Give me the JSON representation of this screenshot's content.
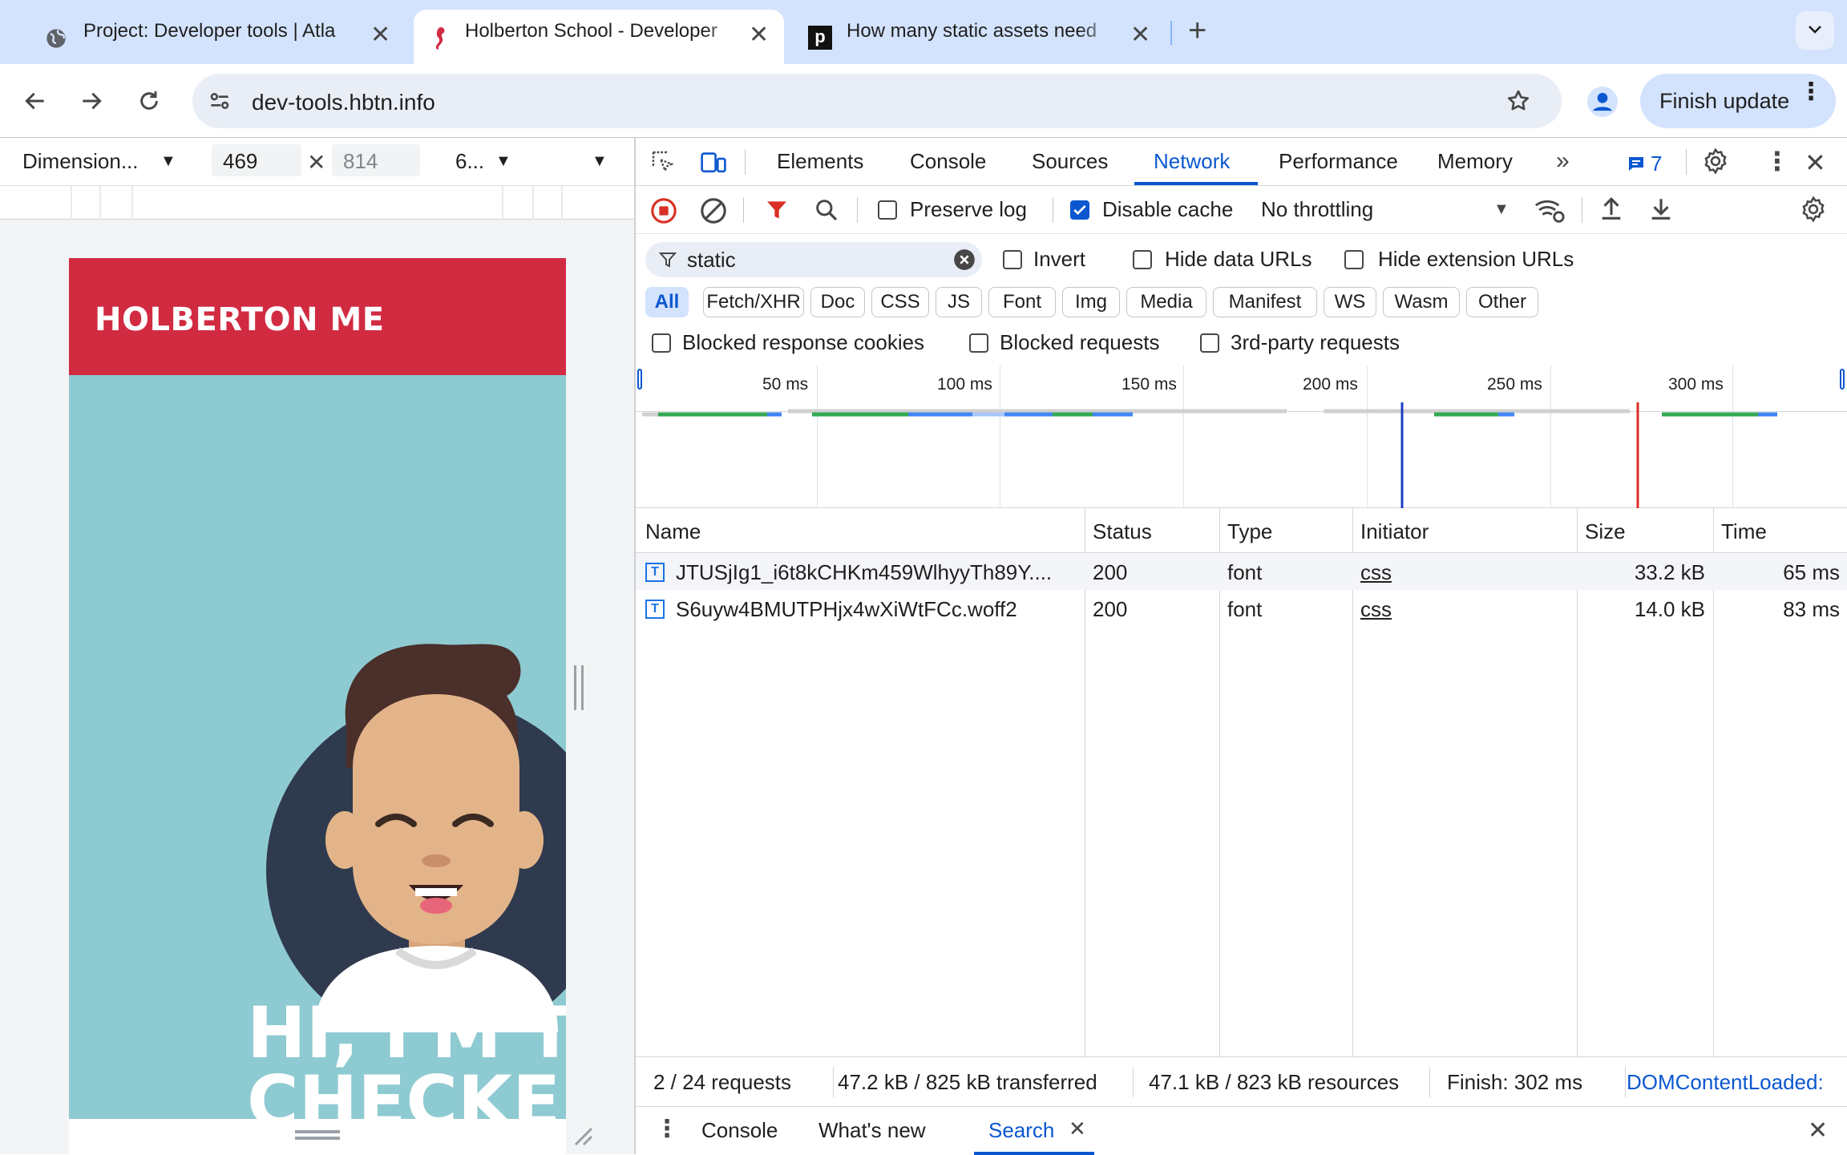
{
  "browser": {
    "tabs": [
      {
        "title": "Project: Developer tools | Atla",
        "favicon": "globe-icon"
      },
      {
        "title": "Holberton School - Developer",
        "favicon": "holberton-seahorse-icon"
      },
      {
        "title": "How many static assets need",
        "favicon": "p-letter-icon"
      }
    ],
    "url": "dev-tools.hbtn.info",
    "finish_update": "Finish update"
  },
  "device_toolbar": {
    "dimensions": "Dimension...",
    "width": "469",
    "height": "814",
    "zoom": "6..."
  },
  "site": {
    "brand": "HOLBERTON ME",
    "hero_line1": "HI, I'M TH",
    "hero_line2": "CHECKEI"
  },
  "devtools": {
    "tabs": [
      "Elements",
      "Console",
      "Sources",
      "Network",
      "Performance",
      "Memory"
    ],
    "active_tab": "Network",
    "issues_count": "7",
    "toolbar": {
      "preserve_log": "Preserve log",
      "disable_cache": "Disable cache",
      "throttling": "No throttling"
    },
    "filter": {
      "value": "static",
      "invert": "Invert",
      "hide_data_urls": "Hide data URLs",
      "hide_extension_urls": "Hide extension URLs",
      "types": [
        "All",
        "Fetch/XHR",
        "Doc",
        "CSS",
        "JS",
        "Font",
        "Img",
        "Media",
        "Manifest",
        "WS",
        "Wasm",
        "Other"
      ],
      "blocked_response_cookies": "Blocked response cookies",
      "blocked_requests": "Blocked requests",
      "third_party_requests": "3rd-party requests"
    },
    "overview_ticks": [
      "50 ms",
      "100 ms",
      "150 ms",
      "200 ms",
      "250 ms",
      "300 ms"
    ],
    "columns": [
      "Name",
      "Status",
      "Type",
      "Initiator",
      "Size",
      "Time"
    ],
    "rows": [
      {
        "name": "JTUSjIg1_i6t8kCHKm459WlhyyTh89Y....",
        "status": "200",
        "type": "font",
        "initiator": "css",
        "size": "33.2 kB",
        "time": "65 ms"
      },
      {
        "name": "S6uyw4BMUTPHjx4wXiWtFCc.woff2",
        "status": "200",
        "type": "font",
        "initiator": "css",
        "size": "14.0 kB",
        "time": "83 ms"
      }
    ],
    "status": {
      "requests": "2 / 24 requests",
      "transferred": "47.2 kB / 825 kB transferred",
      "resources": "47.1 kB / 823 kB resources",
      "finish": "Finish: 302 ms",
      "dcl": "DOMContentLoaded:"
    },
    "drawer": {
      "tabs": [
        "Console",
        "What's new",
        "Search"
      ],
      "active": "Search"
    }
  },
  "colors": {
    "accent": "#0b57d0",
    "brand_red": "#d12b42",
    "hero_teal": "#8ecad1"
  }
}
